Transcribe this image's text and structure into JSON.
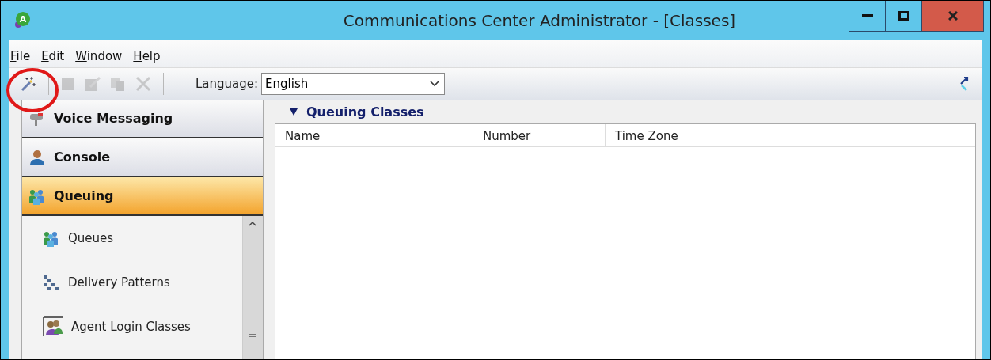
{
  "window": {
    "title": "Communications Center Administrator - [Classes]",
    "logo_letter": "A"
  },
  "menu": [
    "File",
    "Edit",
    "Window",
    "Help"
  ],
  "toolbar": {
    "buttons": [
      {
        "kind": "wand",
        "disabled": false
      },
      {
        "kind": "new",
        "disabled": true
      },
      {
        "kind": "edit",
        "disabled": true
      },
      {
        "kind": "copy",
        "disabled": true
      },
      {
        "kind": "delete",
        "disabled": true
      }
    ],
    "language_label": "Language:",
    "language_value": "English"
  },
  "sidebar": {
    "sections": [
      {
        "label": "Voice Messaging",
        "kind": "mailbox",
        "selected": false
      },
      {
        "label": "Console",
        "kind": "person",
        "selected": false
      },
      {
        "label": "Queuing",
        "kind": "group",
        "selected": true
      }
    ],
    "items": [
      {
        "label": "Queues",
        "kind": "group"
      },
      {
        "label": "Delivery Patterns",
        "kind": "pattern"
      },
      {
        "label": "Agent Login Classes",
        "kind": "agents"
      }
    ]
  },
  "panel": {
    "title": "Queuing Classes",
    "expanded": true,
    "columns": [
      "Name",
      "Number",
      "Time Zone"
    ]
  }
}
